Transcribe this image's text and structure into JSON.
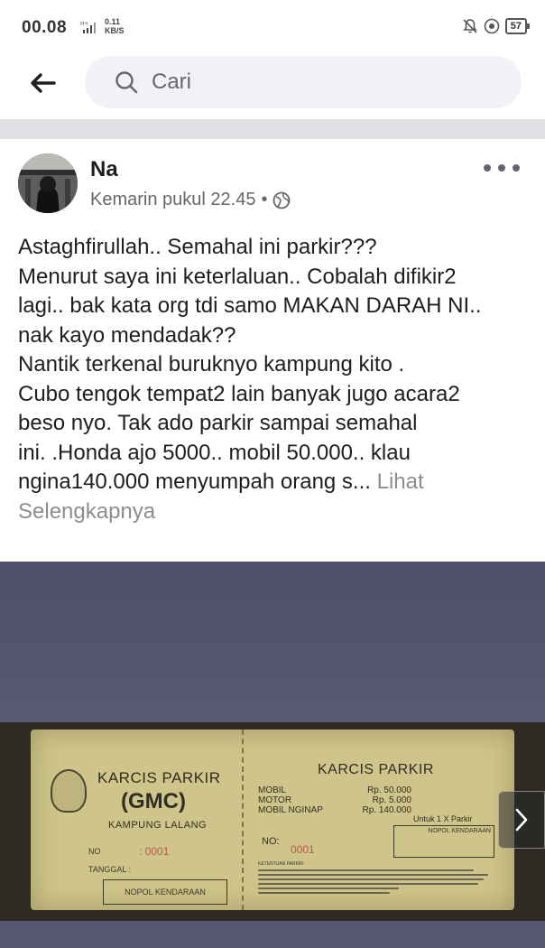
{
  "status_bar": {
    "time": "00.08",
    "speed_value": "0.11",
    "speed_unit": "KB/S",
    "battery": "57",
    "icons": [
      "signal-icon",
      "bell-off-icon",
      "at-icon",
      "battery-icon"
    ]
  },
  "search": {
    "placeholder": "Cari"
  },
  "post": {
    "author": "Na",
    "timestamp": "Kemarin pukul 22.45",
    "separator": "•",
    "privacy_icon": "globe-icon",
    "body_lines": [
      "Astaghfirullah.. Semahal ini parkir???",
      "Menurut saya ini keterlaluan.. Cobalah difikir2",
      "lagi.. bak kata org tdi samo MAKAN DARAH NI..",
      "nak kayo mendadak??",
      "Nantik terkenal buruknyo kampung kito .",
      "Cubo tengok tempat2 lain banyak jugo acara2",
      "beso nyo. Tak ado parkir sampai semahal",
      "ini. .Honda ajo 5000.. mobil 50.000.. klau",
      "ngina140.000 menyumpah orang s..."
    ],
    "see_more_part1": "Lihat",
    "see_more_part2": "Selengkapnya"
  },
  "ticket": {
    "title_left": "KARCIS PARKIR",
    "subtitle_left": "(GMC)",
    "location": "KAMPUNG LALANG",
    "no_label": "NO",
    "no_value": ": 0001",
    "tanggal_label": "TANGGAL :",
    "nopol_label": "NOPOL KENDARAAN",
    "title_right": "KARCIS PARKIR",
    "rates": [
      {
        "label": "MOBIL",
        "price": "Rp. 50.000"
      },
      {
        "label": "MOTOR",
        "price": "Rp. 5.000"
      },
      {
        "label": "MOBIL NGINAP",
        "price": "Rp. 140.000"
      }
    ],
    "no2_label": "NO:",
    "no2_value": "0001",
    "untuk_label": "Untuk 1 X Parkir",
    "nopol_label_right": "NOPOL KENDARAAN",
    "rules_header": "KETENTUAN PARKIR:"
  },
  "colors": {
    "accent_gray": "#65676b",
    "divider": "#dfe1e5",
    "search_bg": "#f0f2f5"
  }
}
